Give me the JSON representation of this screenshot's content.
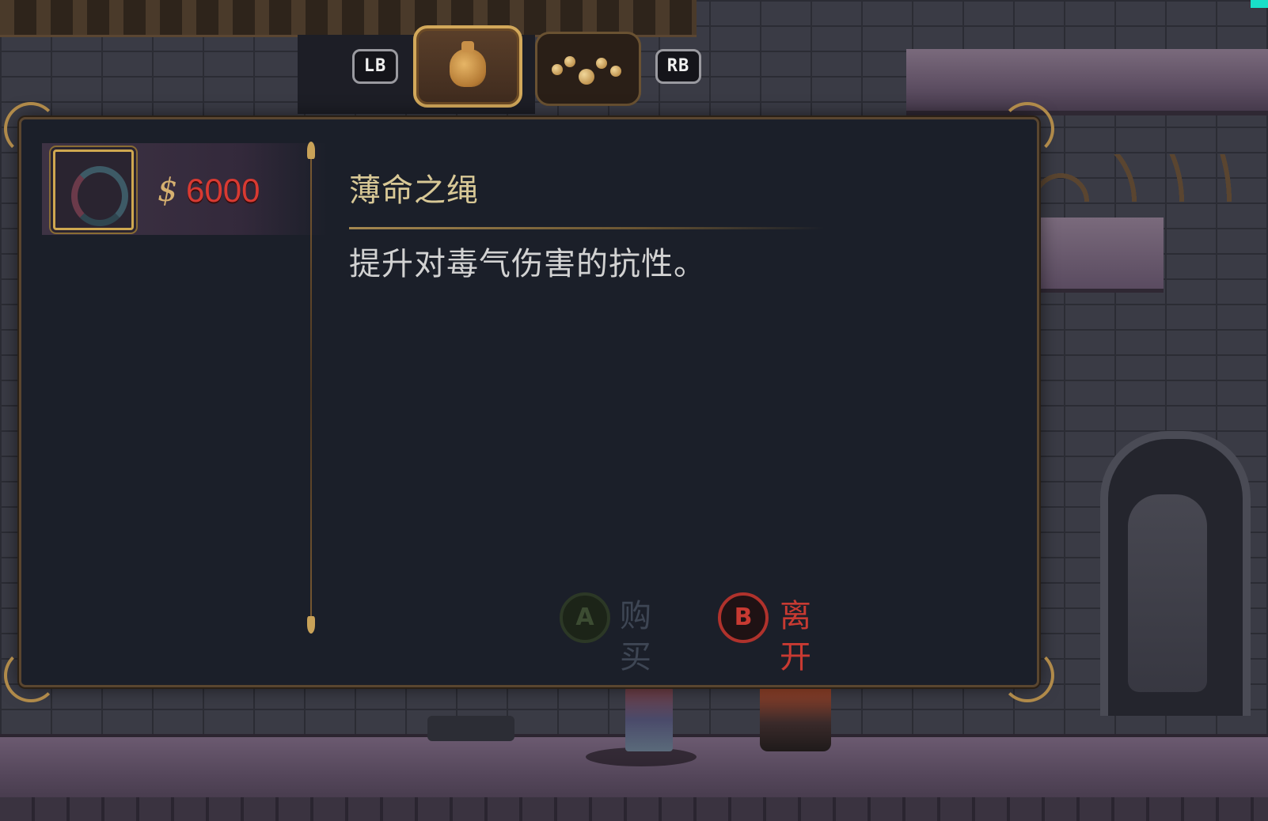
{
  "tabs": {
    "left_bumper": "LB",
    "right_bumper": "RB",
    "items": [
      {
        "icon": "coin-sack-icon",
        "active": true
      },
      {
        "icon": "rosary-beads-icon",
        "active": false
      }
    ]
  },
  "shop_item": {
    "price": "6000",
    "price_icon_glyph": "$",
    "icon": "coiled-rope-icon",
    "title": "薄命之绳",
    "description": "提升对毒气伤害的抗性。"
  },
  "prompts": {
    "buy": {
      "button": "A",
      "label": "购买",
      "enabled": false
    },
    "leave": {
      "button": "B",
      "label": "离开",
      "enabled": true
    }
  },
  "colors": {
    "panel_bg": "#1b1f29",
    "gold": "#cfa850",
    "price_red": "#d83a32",
    "leave_red": "#c83a32"
  }
}
